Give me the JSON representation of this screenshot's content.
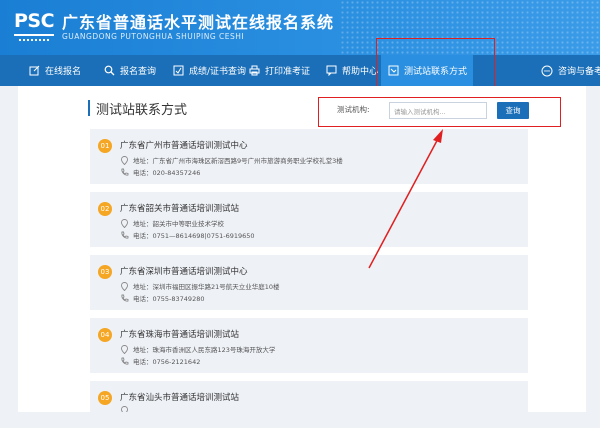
{
  "header": {
    "logo_text": "PSC",
    "title": "广东省普通话水平测试在线报名系统",
    "subtitle": "GUANGDONG PUTONGHUA SHUIPING CESHI"
  },
  "nav": {
    "items": [
      {
        "label": "在线报名",
        "icon": "edit-icon"
      },
      {
        "label": "报名查询",
        "icon": "search-icon"
      },
      {
        "label": "成绩/证书查询",
        "icon": "certificate-icon"
      },
      {
        "label": "打印准考证",
        "icon": "printer-icon"
      },
      {
        "label": "帮助中心",
        "icon": "help-chat-icon"
      },
      {
        "label": "测试站联系方式",
        "icon": "contact-icon",
        "active": true
      },
      {
        "label": "咨询与备考",
        "icon": "chat-bubble-icon"
      }
    ]
  },
  "page": {
    "title": "测试站联系方式"
  },
  "search": {
    "label": "测试机构:",
    "placeholder": "请输入测试机构...",
    "button_label": "查询"
  },
  "stations": [
    {
      "num": "01",
      "name": "广东省广州市普通话培训测试中心",
      "address": "地址：广东省广州市海珠区新滘西路9号广州市旅游商务职业学校礼堂3楼",
      "phone": "电话：020-84357246"
    },
    {
      "num": "02",
      "name": "广东省韶关市普通话培训测试站",
      "address": "地址：韶关市中等职业技术学校",
      "phone": "电话：0751—8614698|0751-6919650"
    },
    {
      "num": "03",
      "name": "广东省深圳市普通话培训测试中心",
      "address": "地址：深圳市福田区振华路21号航天立业华庭10楼",
      "phone": "电话：0755-83749280"
    },
    {
      "num": "04",
      "name": "广东省珠海市普通话培训测试站",
      "address": "地址：珠海市香洲区人民东路123号珠海开放大学",
      "phone": "电话：0756-2121642"
    },
    {
      "num": "05",
      "name": "广东省汕头市普通话培训测试站",
      "address": "",
      "phone": ""
    }
  ],
  "colors": {
    "header_bg": "#1a7fd4",
    "nav_bg": "#1b6fb8",
    "nav_active": "#2a8fe0",
    "badge": "#f5a623",
    "annotation_red": "#e02020"
  }
}
